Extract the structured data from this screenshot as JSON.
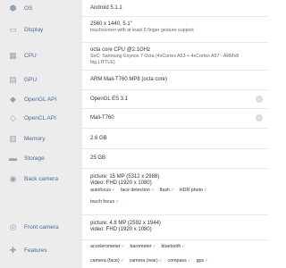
{
  "specs": {
    "os": {
      "label": "OS",
      "value": "Android 5.1.1",
      "icon": "android-icon"
    },
    "display": {
      "label": "Display",
      "value": "2560 x 1440, 5.1\"",
      "sub": "touchscreen with at least 5 finger gesture support",
      "icon": "display-icon"
    },
    "cpu": {
      "label": "CPU",
      "value": "octa core CPU @2.1GHz",
      "sub": "SoC: Samsung Exynos 7 Octa (4xCortex A53 + 4xCortex A57 - ARMv8 big.LITTLE)",
      "icon": "cpu-icon"
    },
    "gpu": {
      "label": "GPU",
      "value": "ARM Mali-T760 MP8 (octa core)",
      "icon": "gpu-icon"
    },
    "opengl_api": {
      "label": "OpenGL API",
      "value": "OpenGL ES 3.1",
      "icon": "opengl-icon"
    },
    "opencl_api": {
      "label": "OpenCL API",
      "value": "Mali-T760",
      "icon": "opencl-icon"
    },
    "memory": {
      "label": "Memory",
      "value": "2.6 GB",
      "icon": "memory-icon"
    },
    "storage": {
      "label": "Storage",
      "value": "25 GB",
      "icon": "storage-icon"
    },
    "back_camera": {
      "label": "Back camera",
      "picture": "picture: 15 MP (5312 x 2988)",
      "video": "video: FHD (1920 x 1080)",
      "features": [
        "autofocus",
        "face detection",
        "flash",
        "HDR photo",
        "touch focus"
      ],
      "icon": "camera-icon"
    },
    "front_camera": {
      "label": "Front camera",
      "picture": "picture: 4.8 MP (2592 x 1944)",
      "video": "video: FHD (1920 x 1080)",
      "icon": "front-camera-icon"
    },
    "features": {
      "label": "Features",
      "row1": [
        "accelerometer",
        "barometer",
        "bluetooth"
      ],
      "row2": [
        "camera (face)",
        "camera (rear)",
        "compass",
        "gps"
      ],
      "icon": "features-icon"
    }
  },
  "colors": {
    "label_bg": "#ececec",
    "label_text": "#4a6a9a",
    "check": "#6aa84f"
  }
}
